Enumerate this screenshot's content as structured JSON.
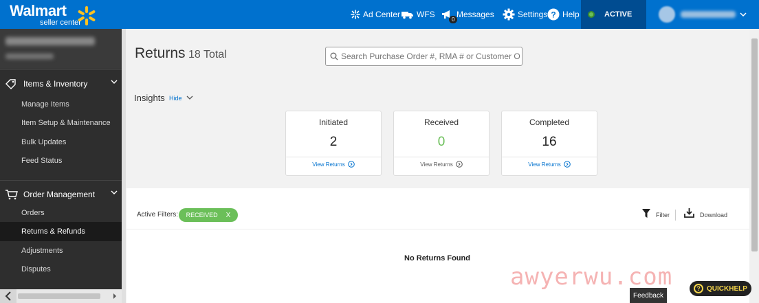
{
  "header": {
    "brand": "Walmart",
    "brand_sub": "seller center",
    "nav": {
      "ad_center": "Ad Center",
      "wfs": "WFS",
      "messages": "Messages",
      "messages_badge": "0",
      "settings": "Settings",
      "help": "Help"
    },
    "status": "ACTIVE"
  },
  "sidebar": {
    "sections": [
      {
        "label": "Items & Inventory",
        "icon": "tag-icon",
        "items": [
          "Manage Items",
          "Item Setup & Maintenance",
          "Bulk Updates",
          "Feed Status"
        ]
      },
      {
        "label": "Order Management",
        "icon": "cart-icon",
        "items": [
          "Orders",
          "Returns & Refunds",
          "Adjustments",
          "Disputes"
        ]
      }
    ],
    "selected_item": "Returns & Refunds"
  },
  "main": {
    "title": "Returns",
    "count": "18 Total",
    "search_placeholder": "Search Purchase Order #, RMA # or Customer Order #",
    "insights_label": "Insights",
    "insights_toggle": "Hide",
    "cards": [
      {
        "label": "Initiated",
        "value": "2",
        "link": "View Returns"
      },
      {
        "label": "Received",
        "value": "0",
        "link": "View Returns"
      },
      {
        "label": "Completed",
        "value": "16",
        "link": "View Returns"
      }
    ],
    "active_filters_label": "Active Filters:",
    "active_filter": "RECEIVED",
    "active_filter_remove": "X",
    "filter_label": "Filter",
    "download_label": "Download",
    "empty_message": "No Returns Found"
  },
  "footer": {
    "feedback": "Feedback",
    "quickhelp": "QUICKHELP",
    "watermark": "awyerwu.com"
  },
  "colors": {
    "header_blue": "#0071ce",
    "active_dark_blue": "#004c91",
    "spark_yellow": "#ffc220",
    "success_green": "#6bbf59",
    "sidebar_dark": "#2e2e2e"
  }
}
